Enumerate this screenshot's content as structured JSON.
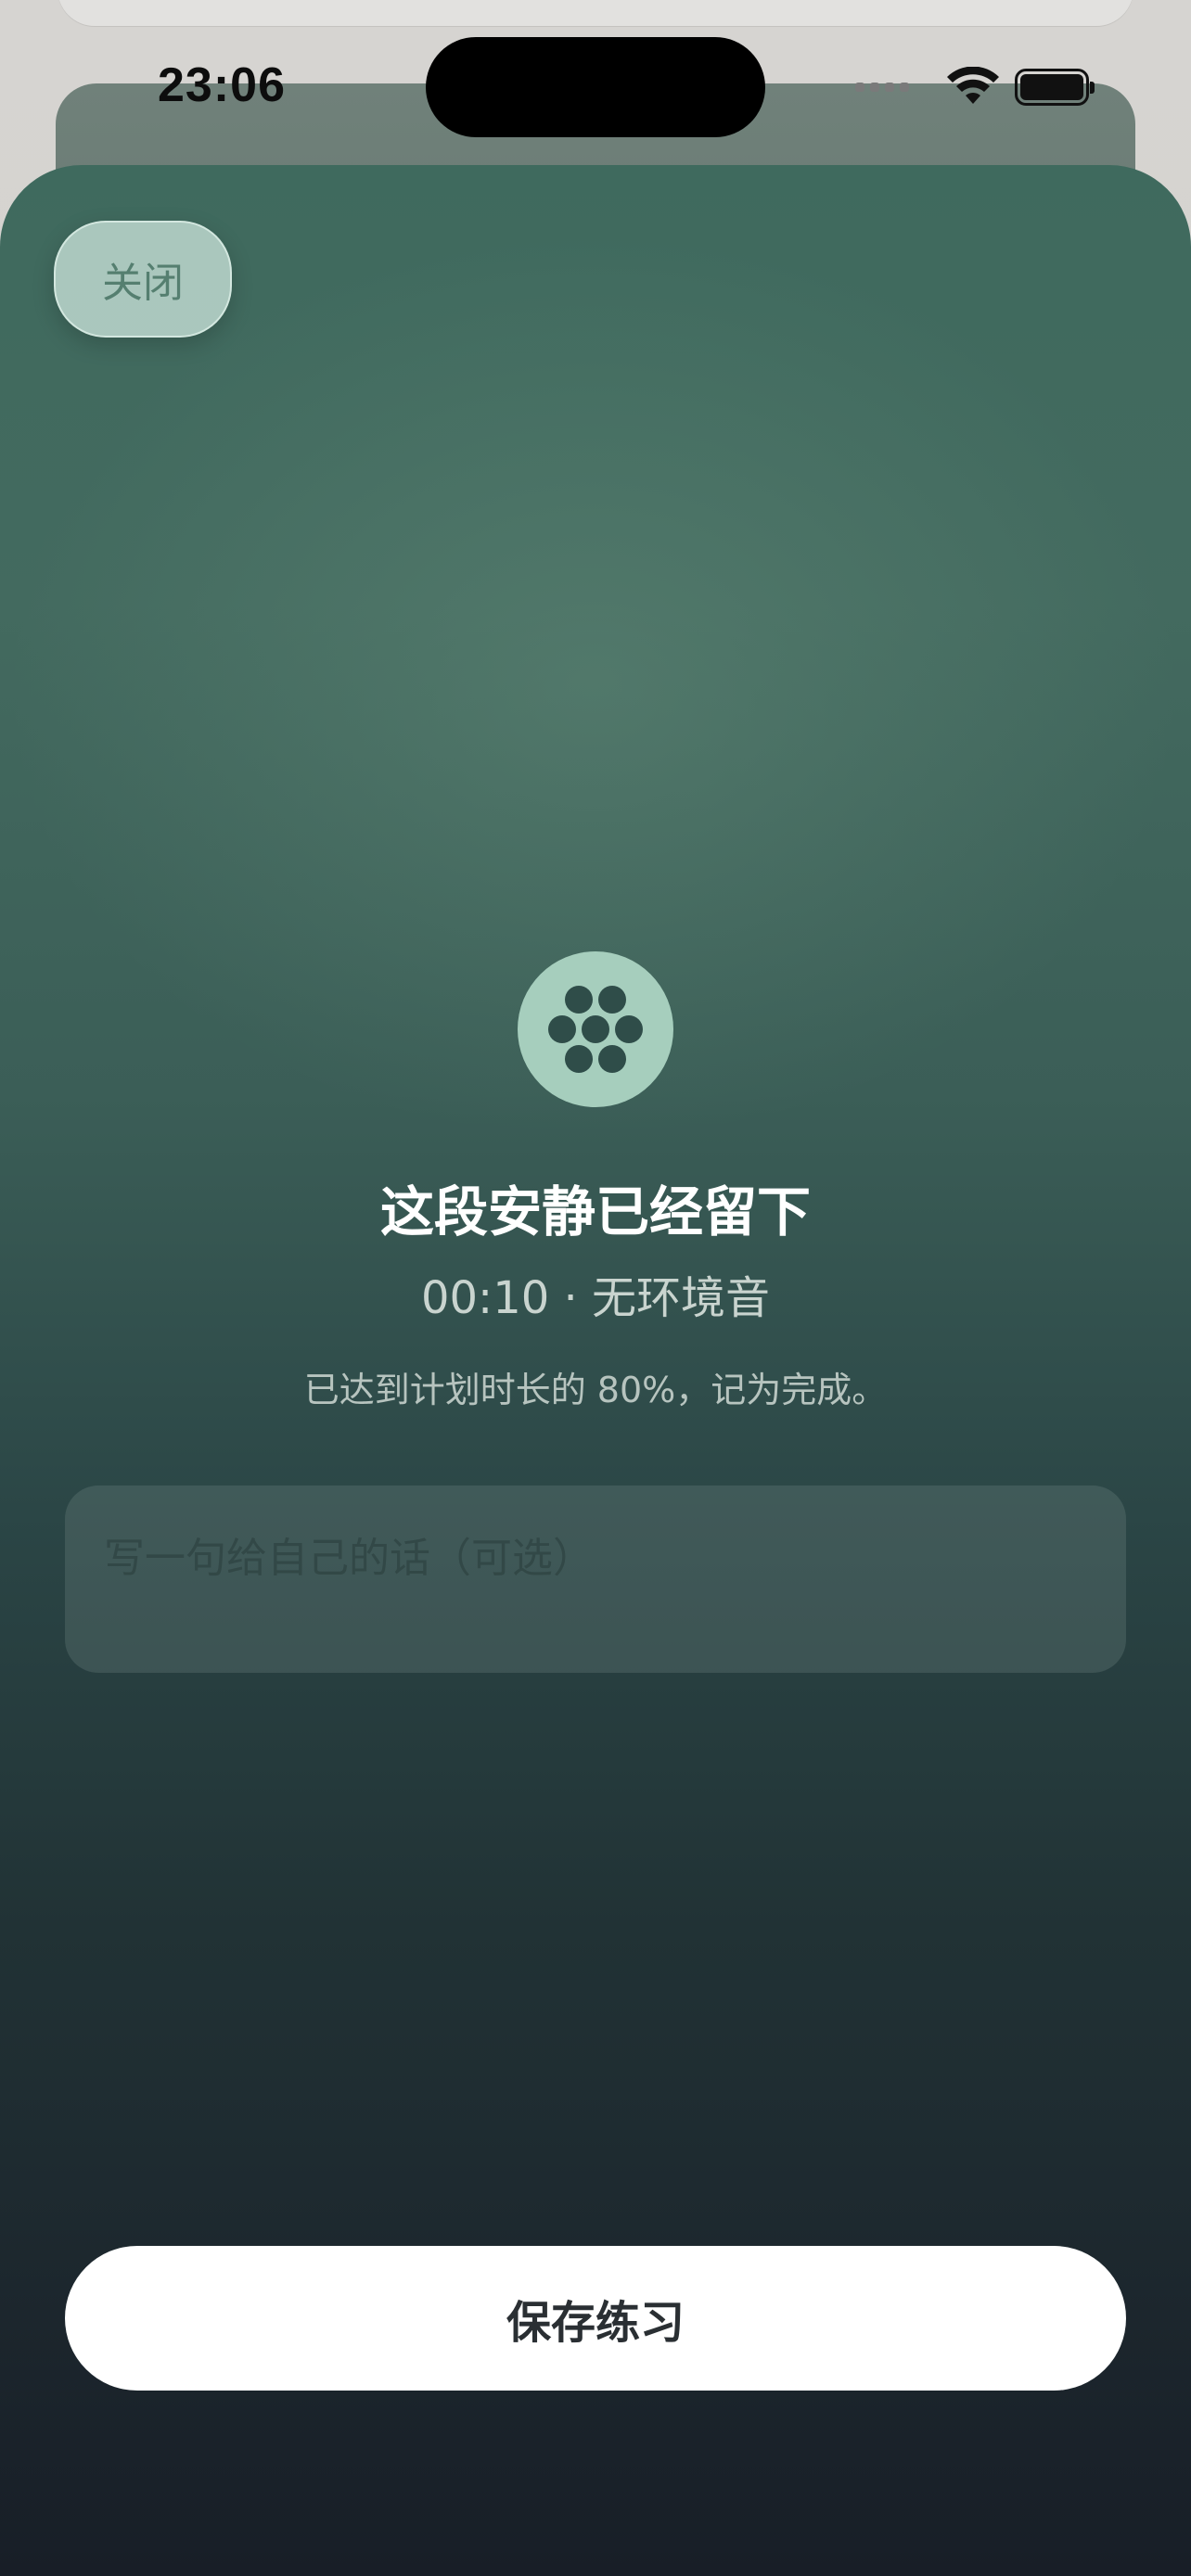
{
  "status_bar": {
    "time": "23:06",
    "icons": [
      "cellular-dots-icon",
      "wifi-icon",
      "battery-icon"
    ]
  },
  "sheet": {
    "close_label": "关闭",
    "badge_icon": "flower-dots-icon",
    "title": "这段安静已经留下",
    "subtitle": "00:10 · 无环境音",
    "note": "已达到计划时长的 80%，记为完成。",
    "note_placeholder": "写一句给自己的话（可选）",
    "save_label": "保存练习"
  },
  "colors": {
    "accent": "#a6cebd",
    "sheet_top": "#3f6a5e",
    "sheet_bottom": "#171d26",
    "button_bg": "#ffffff"
  }
}
